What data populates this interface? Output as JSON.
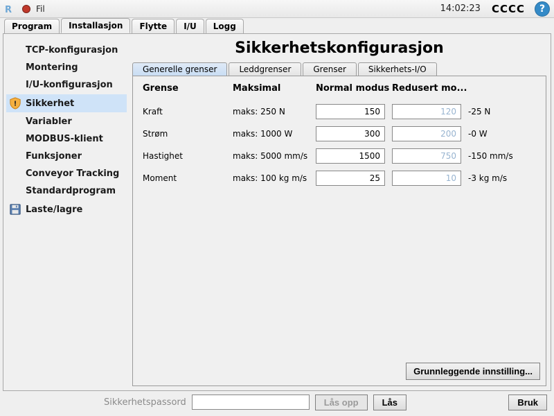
{
  "menubar": {
    "fil": "Fil",
    "clock": "14:02:23",
    "checks": "CCCC",
    "help": "?"
  },
  "maintabs": [
    {
      "label": "Program"
    },
    {
      "label": "Installasjon",
      "active": true
    },
    {
      "label": "Flytte"
    },
    {
      "label": "I/U"
    },
    {
      "label": "Logg"
    }
  ],
  "sidebar": {
    "items": [
      {
        "label": "TCP-konfigurasjon"
      },
      {
        "label": "Montering"
      },
      {
        "label": "I/U-konfigurasjon"
      },
      {
        "label": "Sikkerhet",
        "selected": true,
        "icon": "shield"
      },
      {
        "label": "Variabler"
      },
      {
        "label": "MODBUS-klient"
      },
      {
        "label": "Funksjoner"
      },
      {
        "label": "Conveyor Tracking"
      },
      {
        "label": "Standardprogram"
      },
      {
        "label": "Laste/lagre",
        "icon": "disk"
      }
    ]
  },
  "panel": {
    "title": "Sikkerhetskonfigurasjon",
    "subtabs": [
      {
        "label": "Generelle grenser",
        "active": true
      },
      {
        "label": "Leddgrenser"
      },
      {
        "label": "Grenser"
      },
      {
        "label": "Sikkerhets-I/O"
      }
    ],
    "headers": {
      "grense": "Grense",
      "maks": "Maksimal",
      "normal": "Normal modus",
      "redusert": "Redusert mo..."
    },
    "rows": [
      {
        "name": "Kraft",
        "max": "maks: 250 N",
        "normal": "150",
        "reduced": "120",
        "extra": "-25 N"
      },
      {
        "name": "Strøm",
        "max": "maks: 1000 W",
        "normal": "300",
        "reduced": "200",
        "extra": "-0 W"
      },
      {
        "name": "Hastighet",
        "max": "maks: 5000 mm/s",
        "normal": "1500",
        "reduced": "750",
        "extra": "-150 mm/s"
      },
      {
        "name": "Moment",
        "max": "maks: 100 kg m/s",
        "normal": "25",
        "reduced": "10",
        "extra": "-3 kg m/s"
      }
    ],
    "basic_button": "Grunnleggende innstilling..."
  },
  "footer": {
    "pw_label": "Sikkerhetspassord",
    "unlock": "Lås opp",
    "lock": "Lås",
    "use": "Bruk"
  }
}
